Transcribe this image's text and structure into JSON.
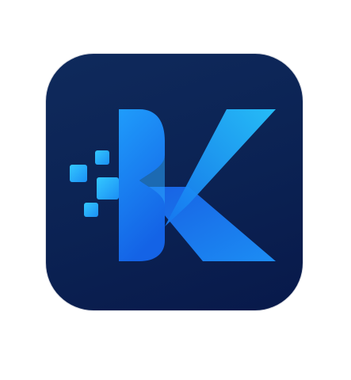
{
  "app_icon": {
    "glyph": "K",
    "icon_name": "k-logo-icon",
    "colors": {
      "background_dark": "#0b2253",
      "accent_light": "#27c4ff",
      "accent_mid": "#1a8cf5",
      "accent_deep": "#1463e6"
    }
  }
}
